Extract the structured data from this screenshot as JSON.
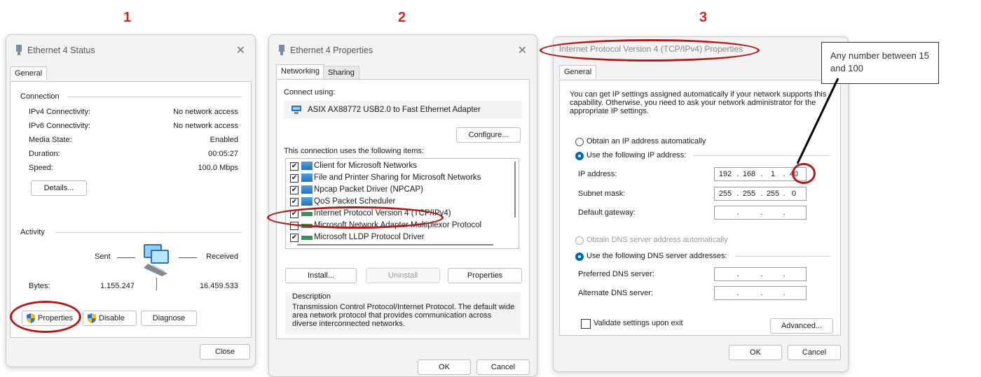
{
  "steps": [
    "1",
    "2",
    "3"
  ],
  "status_dialog": {
    "title": "Ethernet 4 Status",
    "tab": "General",
    "connection_label": "Connection",
    "rows": [
      {
        "label": "IPv4 Connectivity:",
        "value": "No network access"
      },
      {
        "label": "IPv6 Connectivity:",
        "value": "No network access"
      },
      {
        "label": "Media State:",
        "value": "Enabled"
      },
      {
        "label": "Duration:",
        "value": "00:05:27"
      },
      {
        "label": "Speed:",
        "value": "100.0 Mbps"
      }
    ],
    "details_button": "Details...",
    "activity_label": "Activity",
    "sent_label": "Sent",
    "received_label": "Received",
    "bytes_label": "Bytes:",
    "bytes_sent": "1.155.247",
    "bytes_received": "16.459.533",
    "properties_button": "Properties",
    "disable_button": "Disable",
    "diagnose_button": "Diagnose",
    "close_button": "Close"
  },
  "properties_dialog": {
    "title": "Ethernet 4 Properties",
    "tabs": [
      "Networking",
      "Sharing"
    ],
    "connect_using_label": "Connect using:",
    "adapter": "ASIX AX88772 USB2.0 to Fast Ethernet Adapter",
    "configure_button": "Configure...",
    "items_label": "This connection uses the following items:",
    "items": [
      {
        "label": "Client for Microsoft Networks",
        "checked": true
      },
      {
        "label": "File and Printer Sharing for Microsoft Networks",
        "checked": true
      },
      {
        "label": "Npcap Packet Driver (NPCAP)",
        "checked": true
      },
      {
        "label": "QoS Packet Scheduler",
        "checked": true
      },
      {
        "label": "Internet Protocol Version 4 (TCP/IPv4)",
        "checked": true
      },
      {
        "label": "Microsoft Network Adapter Multiplexor Protocol",
        "checked": false
      },
      {
        "label": "Microsoft LLDP Protocol Driver",
        "checked": true
      }
    ],
    "install_button": "Install...",
    "uninstall_button": "Uninstall",
    "properties_button": "Properties",
    "description_label": "Description",
    "description_text": "Transmission Control Protocol/Internet Protocol. The default wide area network protocol that provides communication across diverse interconnected networks.",
    "ok_button": "OK",
    "cancel_button": "Cancel"
  },
  "ipv4_dialog": {
    "title": "Internet Protocol Version 4 (TCP/IPv4) Properties",
    "tab": "General",
    "intro": "You can get IP settings assigned automatically if your network supports this capability. Otherwise, you need to ask your network administrator for the appropriate IP settings.",
    "obtain_ip_auto": "Obtain an IP address automatically",
    "use_following_ip": "Use the following IP address:",
    "ip_address_label": "IP address:",
    "ip_address": [
      "192",
      "168",
      "1",
      "40"
    ],
    "subnet_label": "Subnet mask:",
    "subnet": [
      "255",
      "255",
      "255",
      "0"
    ],
    "gateway_label": "Default gateway:",
    "obtain_dns_auto": "Obtain DNS server address automatically",
    "use_following_dns": "Use the following DNS server addresses:",
    "preferred_dns_label": "Preferred DNS server:",
    "alternate_dns_label": "Alternate DNS server:",
    "validate_label": "Validate settings upon exit",
    "advanced_button": "Advanced...",
    "ok_button": "OK",
    "cancel_button": "Cancel"
  },
  "callout": {
    "text": "Any number between 15 and 100"
  },
  "colors": {
    "step_red": "#e0201c",
    "highlight_red": "#b01c1c",
    "radio_blue": "#0067c0"
  }
}
